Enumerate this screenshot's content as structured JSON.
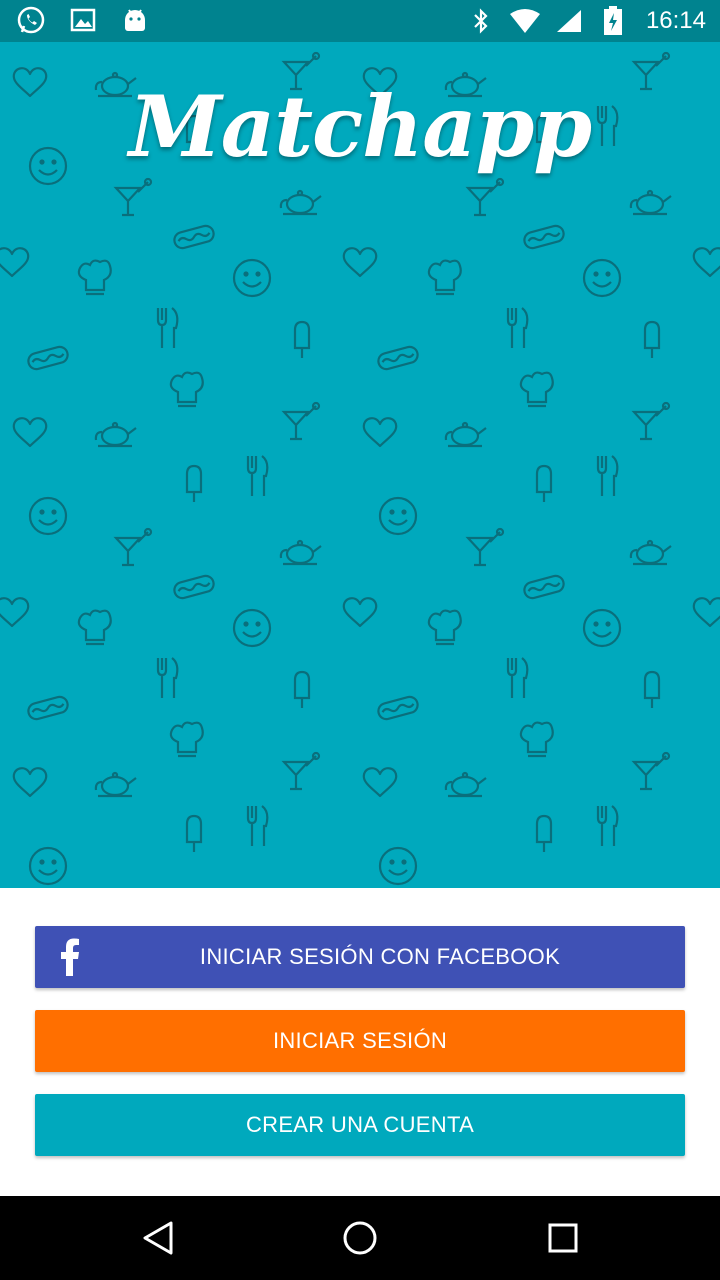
{
  "status_bar": {
    "time": "16:14",
    "left_icons": [
      "whatsapp-icon",
      "image-icon",
      "android-icon"
    ],
    "right_icons": [
      "bluetooth-icon",
      "wifi-icon",
      "signal-icon",
      "battery-charging-icon"
    ]
  },
  "app": {
    "logo_text": "Matchapp",
    "background_color": "#00a9bd"
  },
  "buttons": {
    "facebook_label": "INICIAR SESIÓN CON FACEBOOK",
    "login_label": "INICIAR SESIÓN",
    "create_account_label": "CREAR UNA CUENTA",
    "facebook_color": "#3f51b5",
    "login_color": "#ff6f00",
    "create_color": "#00a9bd"
  },
  "nav_bar": {
    "icons": [
      "back-icon",
      "home-icon",
      "recents-icon"
    ]
  }
}
